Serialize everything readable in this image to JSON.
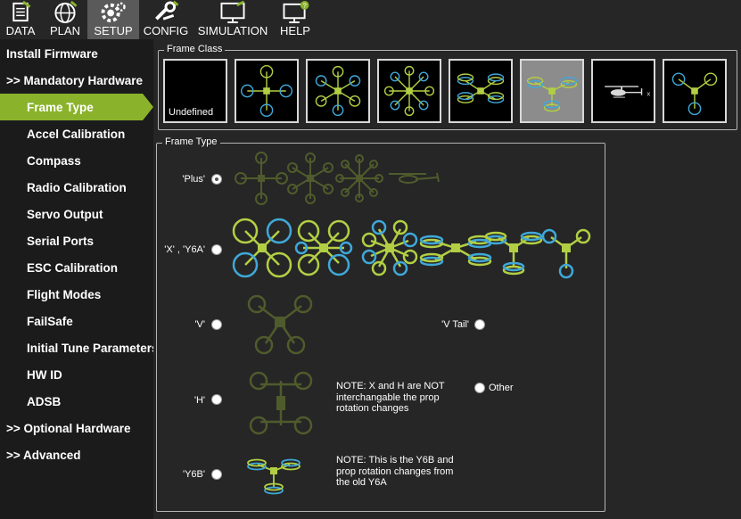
{
  "topbar": {
    "buttons": [
      {
        "label": "DATA",
        "icon": "data-icon"
      },
      {
        "label": "PLAN",
        "icon": "plan-globe-icon"
      },
      {
        "label": "SETUP",
        "icon": "setup-gear-icon",
        "active": true
      },
      {
        "label": "CONFIG",
        "icon": "config-wrench-icon"
      },
      {
        "label": "SIMULATION",
        "icon": "simulation-monitor-icon"
      },
      {
        "label": "HELP",
        "icon": "help-monitor-icon"
      }
    ]
  },
  "sidebar": {
    "items": [
      {
        "label": "Install Firmware"
      },
      {
        "label": ">> Mandatory Hardware"
      },
      {
        "label": "Frame Type",
        "selected": true
      },
      {
        "label": "Accel Calibration"
      },
      {
        "label": "Compass"
      },
      {
        "label": "Radio Calibration"
      },
      {
        "label": "Servo Output"
      },
      {
        "label": "Serial Ports"
      },
      {
        "label": "ESC Calibration"
      },
      {
        "label": "Flight Modes"
      },
      {
        "label": "FailSafe"
      },
      {
        "label": "Initial Tune Parameters"
      },
      {
        "label": "HW ID"
      },
      {
        "label": "ADSB"
      },
      {
        "label": ">> Optional Hardware"
      },
      {
        "label": ">> Advanced"
      }
    ]
  },
  "frame_class": {
    "title": "Frame Class",
    "options": [
      {
        "label": "Undefined",
        "icon": "undefined-frame"
      },
      {
        "icon": "quad-frame-icon"
      },
      {
        "icon": "hexa-frame-icon"
      },
      {
        "icon": "octa-frame-icon"
      },
      {
        "icon": "octaquad-frame-icon"
      },
      {
        "icon": "y6-frame-icon",
        "selected": true
      },
      {
        "icon": "heli-frame-icon"
      },
      {
        "icon": "tri-frame-icon"
      }
    ]
  },
  "frame_type": {
    "title": "Frame Type",
    "options": [
      {
        "label": "'Plus'",
        "selected": true
      },
      {
        "label": "'X' , 'Y6A'"
      },
      {
        "label": "'V'"
      },
      {
        "label": "'V Tail'"
      },
      {
        "label": "'H'"
      },
      {
        "label": "Other"
      },
      {
        "label": "'Y6B'"
      }
    ],
    "note_h": "NOTE: X and H are NOT interchangable the prop rotation changes",
    "note_y6b": "NOTE: This is the Y6B and prop rotation changes from the old Y6A"
  },
  "colors": {
    "accent": "#8ab32b",
    "prop_green": "#b2cf44",
    "prop_blue": "#3fa8d8",
    "dim_olive": "#4f5b2c"
  }
}
